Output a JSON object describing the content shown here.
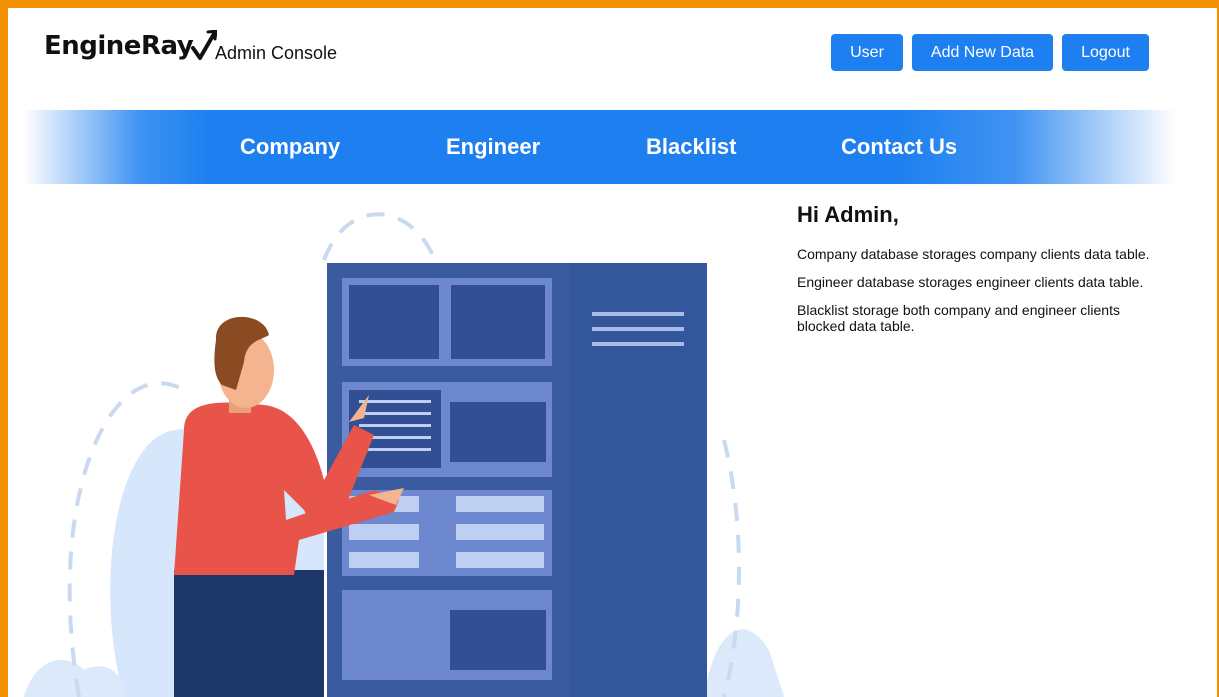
{
  "brand": {
    "name": "EngineRay",
    "subtitle": "Admin Console"
  },
  "header": {
    "buttons": [
      "User",
      "Add New Data",
      "Logout"
    ]
  },
  "nav": {
    "items": [
      "Company",
      "Engineer",
      "Blacklist",
      "Contact Us"
    ]
  },
  "content": {
    "greeting": "Hi Admin,",
    "paragraphs": [
      "Company database storages company clients data table.",
      "Engineer database storages engineer clients data table.",
      "Blacklist storage both company and engineer clients blocked data table."
    ]
  },
  "colors": {
    "accent": "#1E80F0",
    "frame": "#F39200",
    "server": "#3A5BA0"
  }
}
